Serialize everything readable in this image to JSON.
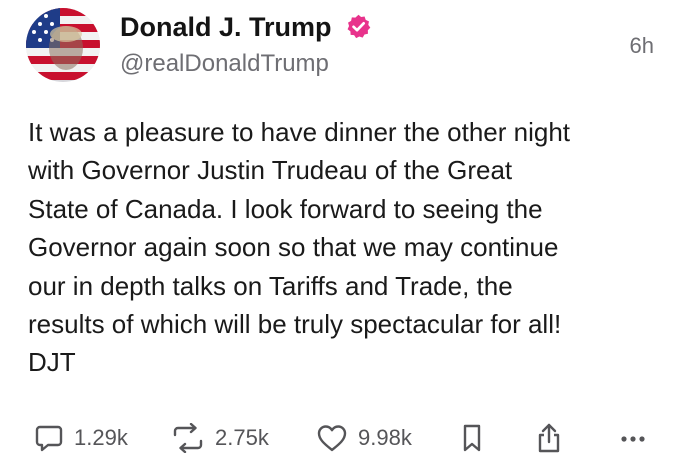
{
  "author": {
    "display_name": "Donald J. Trump",
    "handle": "@realDonaldTrump",
    "verified": true,
    "verified_color": "#e8338c"
  },
  "timestamp": "6h",
  "post": {
    "lines": [
      "It was a pleasure to have dinner the other night",
      "with Governor Justin Trudeau of the Great",
      "State of Canada. I look forward to seeing the",
      "Governor again soon so that we may continue",
      "our in depth talks on Tariffs and Trade, the",
      "results of which will be truly spectacular for all!",
      "DJT"
    ]
  },
  "actions": {
    "reply": {
      "icon": "reply-icon",
      "count": "1.29k"
    },
    "retruth": {
      "icon": "retruth-icon",
      "count": "2.75k"
    },
    "like": {
      "icon": "heart-icon",
      "count": "9.98k"
    },
    "bookmark": {
      "icon": "bookmark-icon"
    },
    "share": {
      "icon": "share-icon"
    },
    "more": {
      "icon": "more-icon"
    }
  }
}
